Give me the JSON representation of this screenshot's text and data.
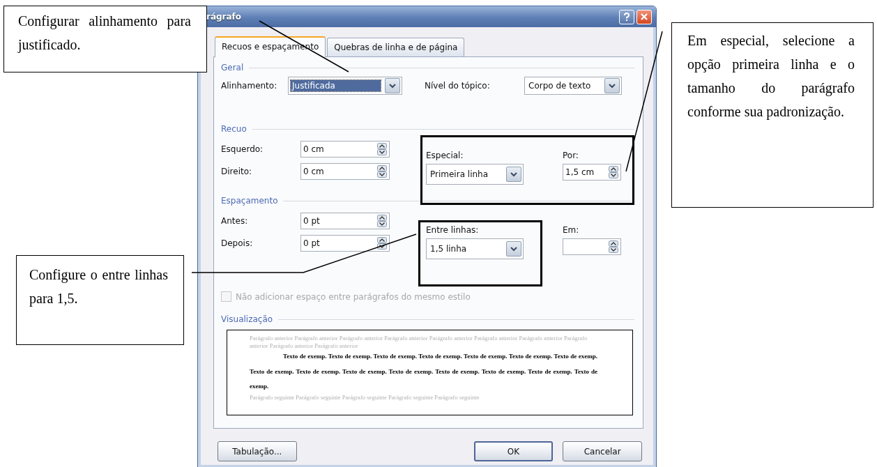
{
  "dialog": {
    "title": "rágrafo",
    "tabs": [
      {
        "label": "Recuos e espaçamento",
        "selected": true
      },
      {
        "label": "Quebras de linha e de página",
        "selected": false
      }
    ],
    "general": {
      "heading": "Geral",
      "alignment": {
        "label": "Alinhamento:",
        "value": "Justificada",
        "focused": true
      },
      "outline_level": {
        "label": "Nível do tópico:",
        "value": "Corpo de texto",
        "focused": false
      }
    },
    "indent": {
      "heading": "Recuo",
      "left": {
        "label": "Esquerdo:",
        "value": "0 cm"
      },
      "right": {
        "label": "Direito:",
        "value": "0 cm"
      },
      "special": {
        "label": "Especial:",
        "value": "Primeira linha",
        "focused": false
      },
      "by": {
        "label": "Por:",
        "value": "1,5 cm"
      }
    },
    "spacing": {
      "heading": "Espaçamento",
      "before": {
        "label": "Antes:",
        "value": "0 pt"
      },
      "after": {
        "label": "Depois:",
        "value": "0 pt"
      },
      "line_spacing": {
        "label": "Entre linhas:",
        "value": "1,5 linha",
        "focused": false
      },
      "at": {
        "label": "Em:"
      }
    },
    "checkbox": {
      "label": "Não adicionar espaço entre parágrafos do mesmo estilo",
      "checked": false,
      "disabled": true
    },
    "preview": {
      "heading": "Visualização",
      "previous": "Parágrafo anterior Parágrafo anterior Parágrafo anterior Parágrafo anterior Parágrafo anterior Parágrafo anterior Parágrafo anterior Parágrafo anterior Parágrafo anterior Parágrafo anterior",
      "sample": "Texto de exemp. Texto de exemp. Texto de exemp. Texto de exemp. Texto de exemp. Texto de exemp. Texto de exemp. Texto de exemp. Texto de exemp. Texto de exemp. Texto de exemp. Texto de exemp. Texto de exemp. Texto de exemp. Texto de exemp.",
      "next": "Parágrafo seguinte Parágrafo seguinte Parágrafo seguinte Parágrafo seguinte Parágrafo seguinte"
    },
    "buttons": [
      {
        "label": "Tabulação...",
        "kind": "normal"
      },
      {
        "label": "OK",
        "kind": "default"
      },
      {
        "label": "Cancelar",
        "kind": "normal"
      }
    ]
  },
  "callouts": [
    {
      "text": "Configurar alinhamento para justificado."
    },
    {
      "text": "Em especial, selecione a opção primeira linha e o tamanho do parágrafo conforme sua padronização."
    },
    {
      "text": "Configure o entre linhas para 1,5."
    }
  ]
}
